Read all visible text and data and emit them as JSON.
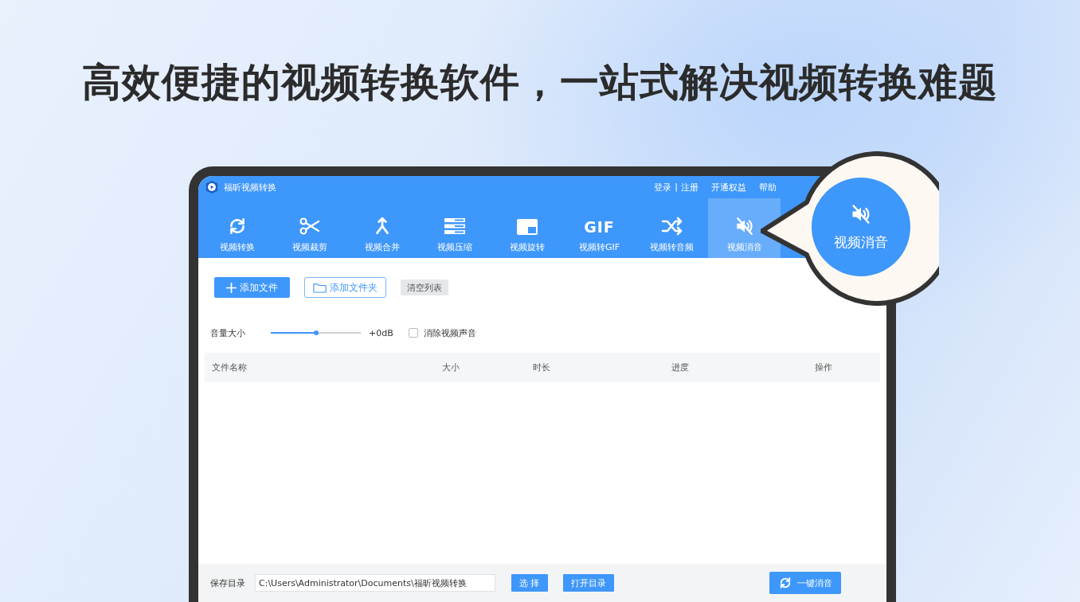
{
  "headline": "高效便捷的视频转换软件，一站式解决视频转换难题",
  "app": {
    "title": "福昕视频转换",
    "top_links": [
      {
        "label": "登录",
        "kind": "link"
      },
      {
        "label": "|",
        "kind": "separator"
      },
      {
        "label": "注册",
        "kind": "link"
      },
      {
        "label": "开通权益",
        "kind": "link"
      },
      {
        "label": "帮助",
        "kind": "link"
      }
    ],
    "tabs": [
      {
        "label": "视频转换",
        "selected": false
      },
      {
        "label": "视频裁剪",
        "selected": false
      },
      {
        "label": "视频合并",
        "selected": false
      },
      {
        "label": "视频压缩",
        "selected": false
      },
      {
        "label": "视频旋转",
        "selected": false
      },
      {
        "label": "视频转GIF",
        "icon_text": "GIF",
        "selected": false
      },
      {
        "label": "视频转音频",
        "selected": false
      },
      {
        "label": "视频消音",
        "selected": true
      }
    ],
    "actions": [
      {
        "label": "添加文件",
        "kind": "primary"
      },
      {
        "label": "添加文件夹",
        "kind": "outline"
      },
      {
        "label": "清空列表",
        "kind": "plain"
      }
    ],
    "volume": {
      "label": "音量大小",
      "level": 0.5,
      "reading": "+0dB"
    },
    "mute_option": {
      "label": "消除视频声音",
      "checked": false
    },
    "table": {
      "columns": [
        "文件名称",
        "大小",
        "时长",
        "进度",
        "操作"
      ]
    },
    "footer": {
      "label": "保存目录",
      "path": "C:\\Users\\Administrator\\Documents\\福昕视频转换",
      "buttons": [
        "选 择",
        "打开目录"
      ],
      "run_button": "一键消音"
    }
  },
  "callout": {
    "label": "视频消音"
  }
}
